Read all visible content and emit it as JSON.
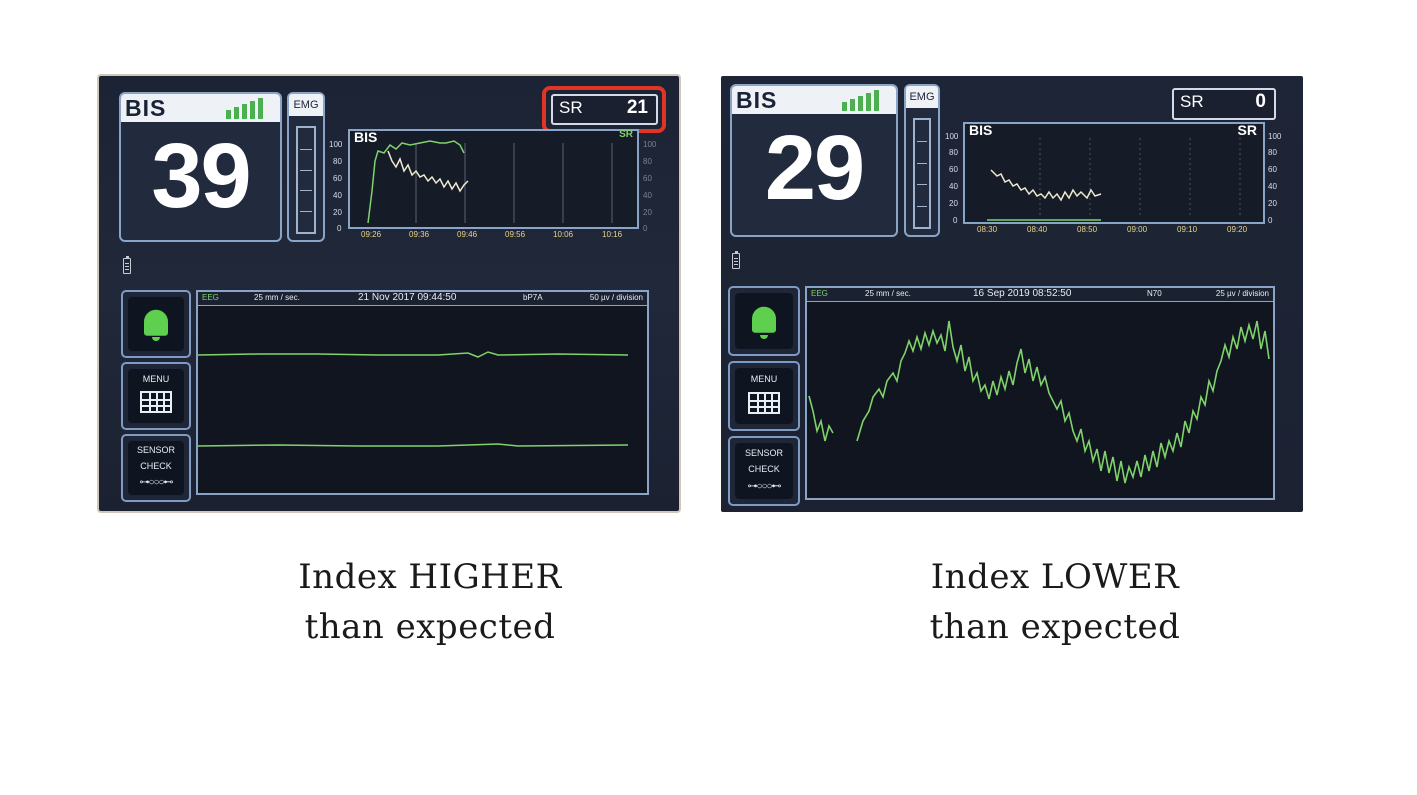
{
  "left_monitor": {
    "bis_label": "BIS",
    "bis_value": "39",
    "emg_label": "EMG",
    "sr_label": "SR",
    "sr_value": "21",
    "trend_title": "BIS",
    "trend_title_right": "SR",
    "y_ticks": [
      "100",
      "80",
      "60",
      "40",
      "20",
      "0"
    ],
    "time_ticks": [
      "09:26",
      "09:36",
      "09:46",
      "09:56",
      "10:06",
      "10:16"
    ],
    "eeg": {
      "tag": "EEG",
      "speed": "25 mm / sec.",
      "datetime": "21 Nov 2017   09:44:50",
      "code": "bP7A",
      "scale": "50 µv / division"
    },
    "buttons": {
      "menu": "MENU",
      "sensor_line1": "SENSOR",
      "sensor_line2": "CHECK",
      "sensor_icon": "⊶○○○⊷"
    },
    "highlight_color": "#e03526"
  },
  "right_monitor": {
    "bis_label": "BIS",
    "bis_value": "29",
    "emg_label": "EMG",
    "sr_label": "SR",
    "sr_value": "0",
    "trend_title": "BIS",
    "trend_title_right": "SR",
    "y_ticks": [
      "100",
      "80",
      "60",
      "40",
      "20",
      "0"
    ],
    "time_ticks": [
      "08:30",
      "08:40",
      "08:50",
      "09:00",
      "09:10",
      "09:20"
    ],
    "eeg": {
      "tag": "EEG",
      "speed": "25 mm / sec.",
      "datetime": "16 Sep 2019   08:52:50",
      "code": "N70",
      "scale": "25 µv / division"
    },
    "buttons": {
      "menu": "MENU",
      "sensor_line1": "SENSOR",
      "sensor_line2": "CHECK",
      "sensor_icon": "⊶○○○⊷"
    }
  },
  "captions": {
    "left_line1": "Index HIGHER",
    "left_line2": "than expected",
    "right_line1": "Index LOWER",
    "right_line2": "than expected"
  },
  "colors": {
    "signal_green": "#7fd36a",
    "bis_bars": "#4caf50",
    "panel_border": "#8aa4c8"
  },
  "icons": [
    "bell-icon",
    "menu-grid-icon",
    "sensor-check-icon",
    "battery-icon",
    "signal-quality-icon"
  ]
}
